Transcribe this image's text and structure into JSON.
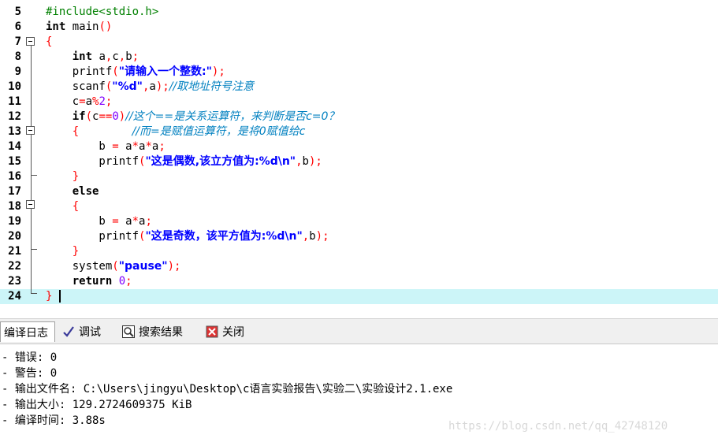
{
  "editor": {
    "lines": [
      {
        "n": "5",
        "html": "<span class=\"pre\">#include&lt;stdio.h&gt;</span>"
      },
      {
        "n": "6",
        "html": "<span class=\"kw\">int</span> main<span class=\"br\">()</span>"
      },
      {
        "n": "7",
        "html": "<span class=\"br\">{</span>"
      },
      {
        "n": "8",
        "html": "    <span class=\"kw\">int</span> a<span class=\"op\">,</span>c<span class=\"op\">,</span>b<span class=\"op\">;</span>"
      },
      {
        "n": "9",
        "html": "    printf<span class=\"br\">(</span><span class=\"str\">\"请输入一个整数:\"</span><span class=\"br\">)</span><span class=\"op\">;</span>"
      },
      {
        "n": "10",
        "html": "    scanf<span class=\"br\">(</span><span class=\"str\">\"%d\"</span><span class=\"op\">,</span>a<span class=\"br\">)</span><span class=\"op\">;</span><span class=\"cmt\">//取地址符号注意</span>"
      },
      {
        "n": "11",
        "html": "    c<span class=\"op\">=</span>a<span class=\"op\">%</span><span class=\"num\">2</span><span class=\"op\">;</span>"
      },
      {
        "n": "12",
        "html": "    <span class=\"kw\">if</span><span class=\"br\">(</span>c<span class=\"op\">==</span><span class=\"num\">0</span><span class=\"br\">)</span><span class=\"cmt\">//这个==是关系运算符，来判断是否c=0？</span>"
      },
      {
        "n": "13",
        "html": "    <span class=\"br\">{</span>        <span class=\"cmt\">//而=是赋值运算符，是将0赋值给c</span>"
      },
      {
        "n": "14",
        "html": "        b <span class=\"op\">=</span> a<span class=\"op\">*</span>a<span class=\"op\">*</span>a<span class=\"op\">;</span>"
      },
      {
        "n": "15",
        "html": "        printf<span class=\"br\">(</span><span class=\"str\">\"这是偶数,该立方值为:%d\\n\"</span><span class=\"op\">,</span>b<span class=\"br\">)</span><span class=\"op\">;</span>"
      },
      {
        "n": "16",
        "html": "    <span class=\"br\">}</span>"
      },
      {
        "n": "17",
        "html": "    <span class=\"kw\">else</span>"
      },
      {
        "n": "18",
        "html": "    <span class=\"br\">{</span>"
      },
      {
        "n": "19",
        "html": "        b <span class=\"op\">=</span> a<span class=\"op\">*</span>a<span class=\"op\">;</span>"
      },
      {
        "n": "20",
        "html": "        printf<span class=\"br\">(</span><span class=\"str\">\"这是奇数，该平方值为:%d\\n\"</span><span class=\"op\">,</span>b<span class=\"br\">)</span><span class=\"op\">;</span>"
      },
      {
        "n": "21",
        "html": "    <span class=\"br\">}</span>"
      },
      {
        "n": "22",
        "html": "    system<span class=\"br\">(</span><span class=\"str\">\"pause\"</span><span class=\"br\">)</span><span class=\"op\">;</span>"
      },
      {
        "n": "23",
        "html": "    <span class=\"kw\">return</span> <span class=\"num\">0</span><span class=\"op\">;</span>"
      },
      {
        "n": "24",
        "html": "<span class=\"br\">}</span>"
      }
    ]
  },
  "tabs": [
    {
      "label": "编译日志",
      "icon": "compile-log-icon"
    },
    {
      "label": "调试",
      "icon": "debug-check-icon"
    },
    {
      "label": "搜索结果",
      "icon": "search-results-icon"
    },
    {
      "label": "关闭",
      "icon": "close-tab-icon"
    }
  ],
  "log": [
    "- 错误: 0",
    "- 警告: 0",
    "- 输出文件名: C:\\Users\\jingyu\\Desktop\\c语言实验报告\\实验二\\实验设计2.1.exe",
    "- 输出大小: 129.2724609375 KiB",
    "- 编译时间: 3.88s"
  ],
  "watermark": "https://blog.csdn.net/qq_42748120"
}
